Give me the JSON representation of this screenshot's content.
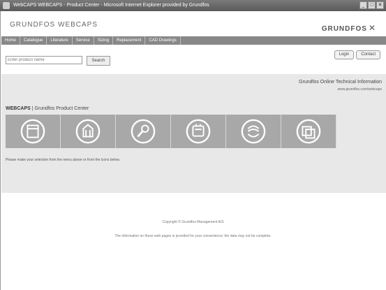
{
  "window": {
    "title": "WebCAPS WEBCAPS - Product Center - Microsoft Internet Explorer provided by Grundfos",
    "controls": [
      "_",
      "□",
      "✕"
    ]
  },
  "header": {
    "brand": "GRUNDFOS WEBCAPS",
    "logo_text": "GRUNDFOS",
    "logo_mark": "✕"
  },
  "nav": {
    "items": [
      "Home",
      "Catalogue",
      "Literature",
      "Service",
      "Sizing",
      "Replacement",
      "CAD Drawings"
    ]
  },
  "search": {
    "placeholder": "Enter product name",
    "button_label": "Search"
  },
  "top_buttons": {
    "login": "Login",
    "contact": "Contact"
  },
  "company": {
    "title": "Grundfos Online Technical Information",
    "link_text": "www.grundfos.com/webcaps"
  },
  "breadcrumb": {
    "prefix": "WEBCAPS",
    "path": "Grundfos Product Center"
  },
  "tiles": [
    {
      "icon": "catalogue-icon"
    },
    {
      "icon": "literature-icon"
    },
    {
      "icon": "service-icon"
    },
    {
      "icon": "sizing-icon"
    },
    {
      "icon": "replacement-icon"
    },
    {
      "icon": "cad-drawings-icon"
    }
  ],
  "notice": "Please make your selection from the menu above or from the icons below.",
  "footer": {
    "copyright": "Copyright © Grundfos Management A/S",
    "disclaimer": "The information on these web pages is provided for your convenience; the data may not be complete."
  },
  "colors": {
    "nav_bg": "#888888",
    "tile_bg": "#a8a8a8",
    "band_bg": "#e8e8e8"
  }
}
